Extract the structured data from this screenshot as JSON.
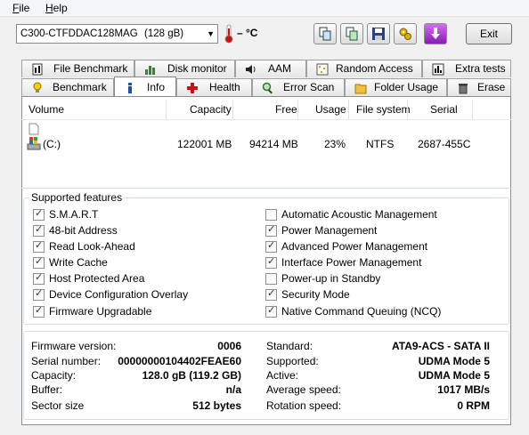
{
  "menu": {
    "file": "File",
    "help": "Help"
  },
  "toolbar": {
    "drive": "C300-CTFDDAC128MAG",
    "drive_size": "(128 gB)",
    "temperature": "– °C",
    "exit_label": "Exit"
  },
  "tabs_top": [
    {
      "label": "File Benchmark"
    },
    {
      "label": "Disk monitor"
    },
    {
      "label": "AAM"
    },
    {
      "label": "Random Access"
    },
    {
      "label": "Extra tests"
    }
  ],
  "tabs_bottom": [
    {
      "label": "Benchmark"
    },
    {
      "label": "Info"
    },
    {
      "label": "Health"
    },
    {
      "label": "Error Scan"
    },
    {
      "label": "Folder Usage"
    },
    {
      "label": "Erase"
    }
  ],
  "volumes": {
    "headers": {
      "volume": "Volume",
      "capacity": "Capacity",
      "free": "Free",
      "usage": "Usage",
      "filesystem": "File system",
      "serial": "Serial"
    },
    "rows": [
      {
        "volume": "(C:)",
        "capacity": "122001 MB",
        "free": "94214 MB",
        "usage": "23%",
        "filesystem": "NTFS",
        "serial": "2687-455C"
      }
    ]
  },
  "features": {
    "title": "Supported features",
    "left": [
      {
        "label": "S.M.A.R.T",
        "checked": true
      },
      {
        "label": "48-bit Address",
        "checked": true
      },
      {
        "label": "Read Look-Ahead",
        "checked": true
      },
      {
        "label": "Write Cache",
        "checked": true
      },
      {
        "label": "Host Protected Area",
        "checked": true
      },
      {
        "label": "Device Configuration Overlay",
        "checked": true
      },
      {
        "label": "Firmware Upgradable",
        "checked": true
      }
    ],
    "right": [
      {
        "label": "Automatic Acoustic Management",
        "checked": false
      },
      {
        "label": "Power Management",
        "checked": true
      },
      {
        "label": "Advanced Power Management",
        "checked": true
      },
      {
        "label": "Interface Power Management",
        "checked": true
      },
      {
        "label": "Power-up in Standby",
        "checked": false
      },
      {
        "label": "Security Mode",
        "checked": true
      },
      {
        "label": "Native Command Queuing (NCQ)",
        "checked": true
      }
    ]
  },
  "info": {
    "left": [
      {
        "label": "Firmware version:",
        "value": "0006"
      },
      {
        "label": "Serial number:",
        "value": "00000000104402FEAE60"
      },
      {
        "label": "Capacity:",
        "value": "128.0 gB (119.2 GB)"
      },
      {
        "label": "Buffer:",
        "value": "n/a"
      },
      {
        "label": "Sector size",
        "value": "512 bytes"
      }
    ],
    "right": [
      {
        "label": "Standard:",
        "value": "ATA9-ACS - SATA II"
      },
      {
        "label": "Supported:",
        "value": "UDMA Mode 5"
      },
      {
        "label": "Active:",
        "value": "UDMA Mode 5"
      },
      {
        "label": "Average speed:",
        "value": "1017 MB/s"
      },
      {
        "label": "Rotation speed:",
        "value": "0 RPM"
      }
    ]
  }
}
